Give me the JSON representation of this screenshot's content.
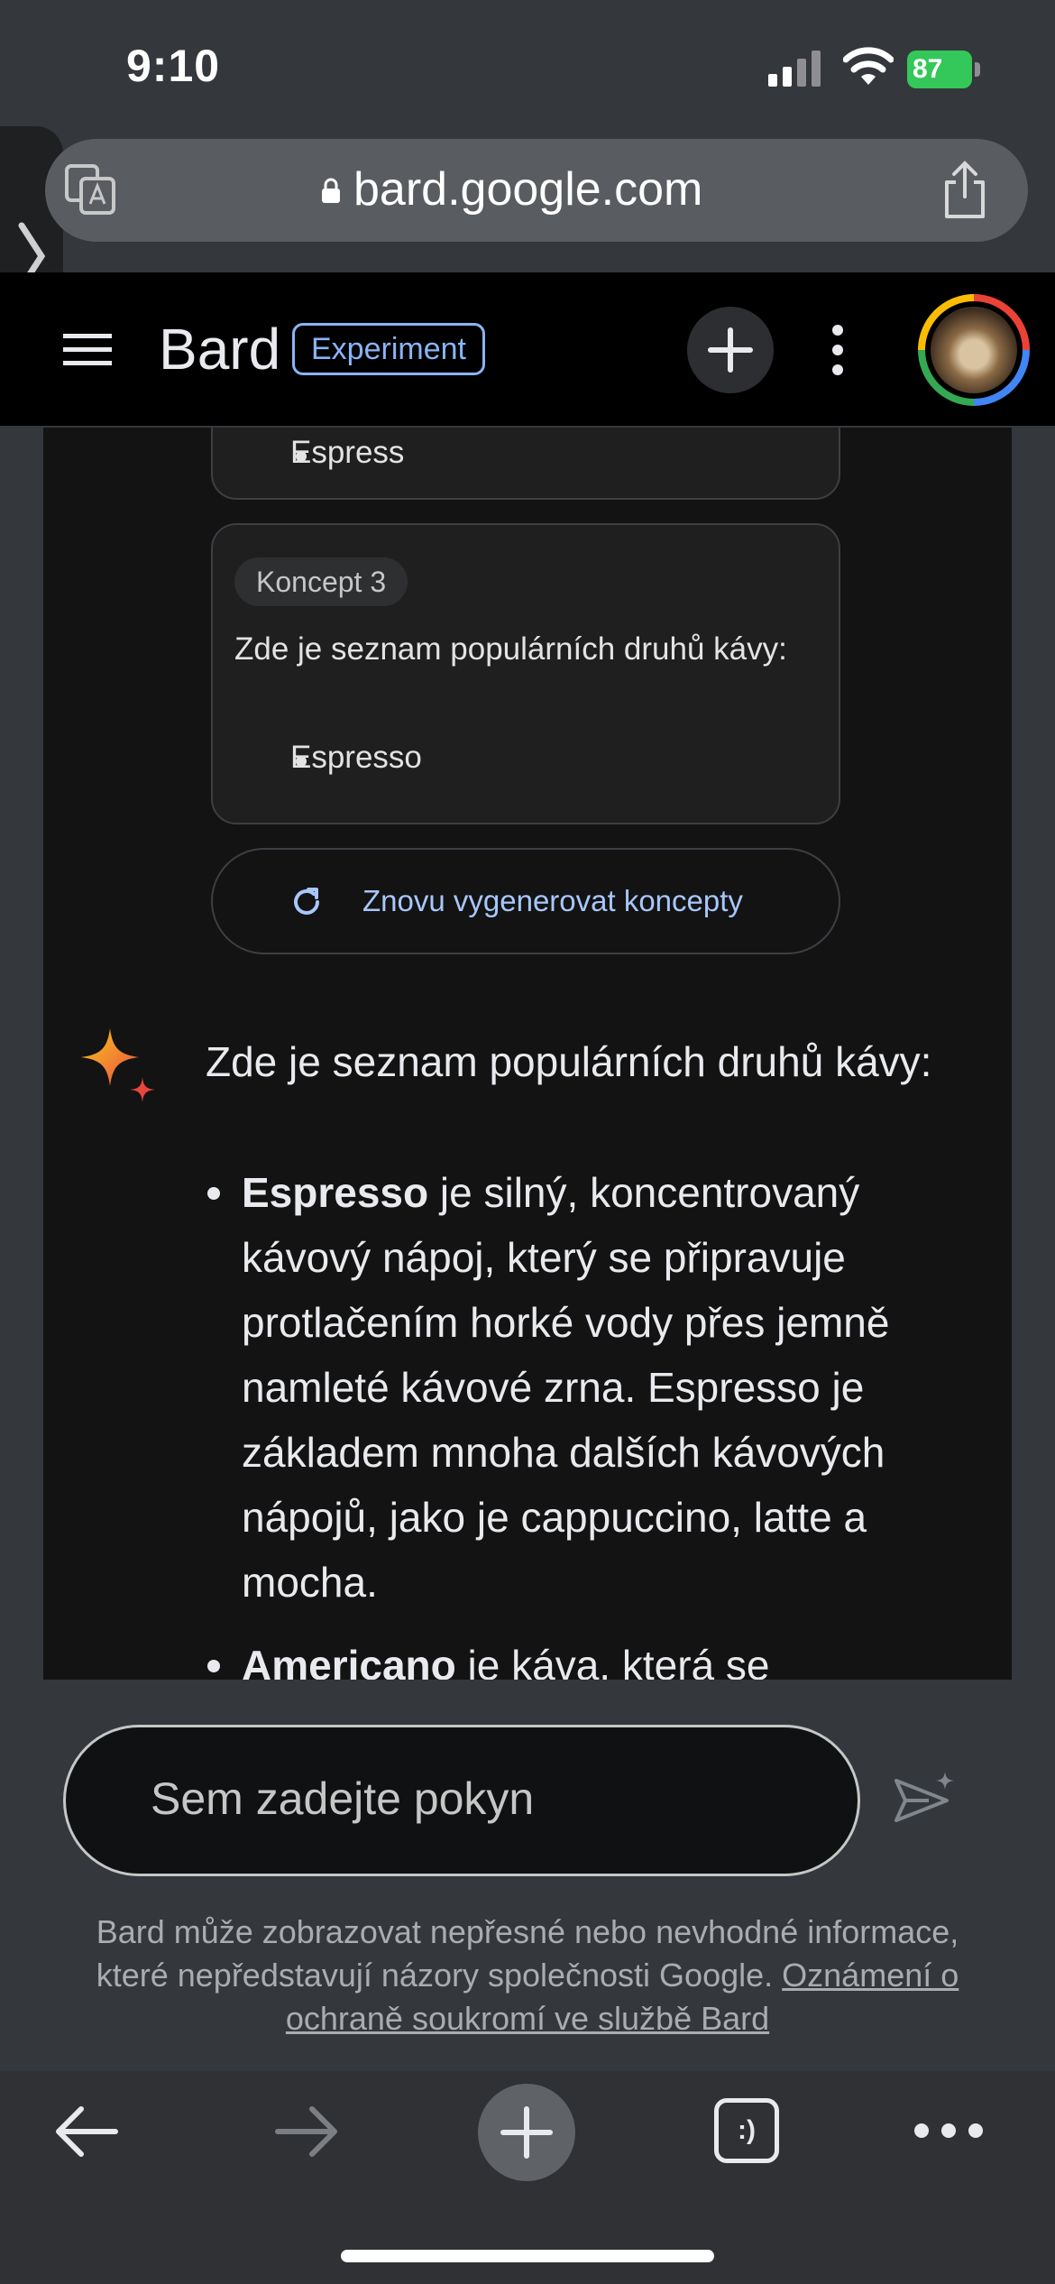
{
  "status_bar": {
    "time": "9:10",
    "battery": "87"
  },
  "browser": {
    "url": "bard.google.com"
  },
  "header": {
    "title": "Bard",
    "badge": "Experiment"
  },
  "drafts": {
    "draft_2_bullet": "Espress",
    "draft_3_chip": "Koncept 3",
    "draft_3_text": "Zde je seznam populárních druhů kávy:",
    "draft_3_bullet": "Espresso",
    "regenerate_label": "Znovu vygenerovat koncepty"
  },
  "answer": {
    "intro": "Zde je seznam populárních druhů kávy:",
    "items": [
      {
        "term": "Espresso",
        "text": " je silný, koncentrovaný kávový nápoj, který se připravuje protlačením horké vody přes jemně namleté kávové zrna. Espresso je základem mnoha dalších kávových nápojů, jako je cappuccino, latte a mocha."
      },
      {
        "term": "Americano",
        "text": " je káva, která se"
      }
    ]
  },
  "input": {
    "placeholder": "Sem zadejte pokyn"
  },
  "disclaimer": {
    "text": "Bard může zobrazovat nepřesné nebo nevhodné informace, které nepředstavují názory společnosti Google. ",
    "link": "Oznámení o ochraně soukromí ve službě Bard"
  },
  "toolbar": {
    "tabs_glyph": ":)"
  }
}
